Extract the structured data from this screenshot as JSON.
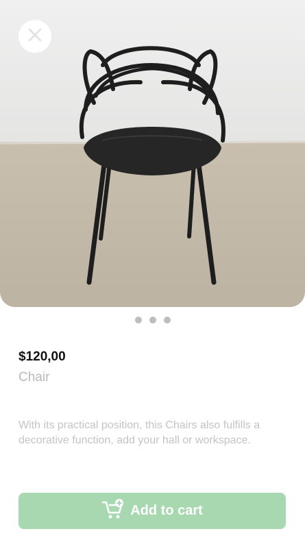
{
  "product": {
    "price": "$120,00",
    "name": "Chair",
    "description": "With its practical position, this Chairs also fulfills a decorative function, add your hall or workspace."
  },
  "gallery": {
    "slide_count": 3,
    "active_index": 0
  },
  "actions": {
    "add_to_cart_label": "Add to cart"
  },
  "icons": {
    "close": "close-icon",
    "cart": "cart-plus-icon"
  },
  "colors": {
    "accent": "#a8d8b0",
    "price": "#111111",
    "muted": "#b9b9b9"
  }
}
